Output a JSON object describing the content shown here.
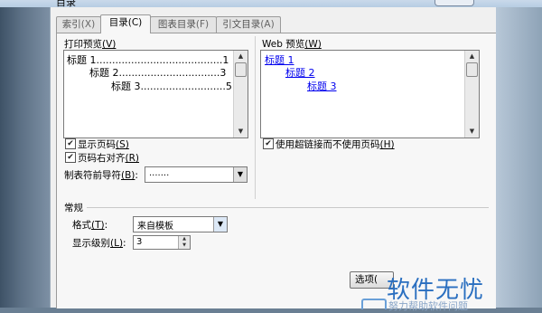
{
  "window": {
    "title": "目录"
  },
  "tabs": [
    {
      "label": "索引",
      "shortcut": "(X)"
    },
    {
      "label": "目录",
      "shortcut": "(C)"
    },
    {
      "label": "图表目录",
      "shortcut": "(F)"
    },
    {
      "label": "引文目录",
      "shortcut": "(A)"
    }
  ],
  "print_preview": {
    "label": "打印预览",
    "shortcut": "(V)",
    "lines": [
      {
        "text": "标题 1",
        "leader": "........................................",
        "page": "1"
      },
      {
        "text": "标题 2",
        "leader": "................................",
        "page": "3"
      },
      {
        "text": "标题 3",
        "leader": "...........................",
        "page": "5"
      }
    ]
  },
  "web_preview": {
    "label": "Web 预览",
    "shortcut": "(W)",
    "links": [
      "标题 1",
      "标题 2",
      "标题 3"
    ]
  },
  "options": {
    "show_page_numbers": {
      "label": "显示页码",
      "shortcut": "(S)",
      "checked": true
    },
    "right_align": {
      "label": "页码右对齐",
      "shortcut": "(R)",
      "checked": true
    },
    "tab_leader": {
      "label": "制表符前导符",
      "shortcut": "(B)",
      "colon": ":",
      "value": "......."
    },
    "use_hyperlinks": {
      "label": "使用超链接而不使用页码",
      "shortcut": "(H)",
      "checked": true
    }
  },
  "general": {
    "heading": "常规",
    "format": {
      "label": "格式",
      "shortcut": "(T)",
      "colon": ":",
      "value": "来自模板"
    },
    "levels": {
      "label": "显示级别",
      "shortcut": "(L)",
      "colon": ":",
      "value": "3"
    }
  },
  "buttons": {
    "options": "选项("
  },
  "watermark": {
    "brand": "软件无忧",
    "sub": "努力帮助软件问题"
  },
  "colors": {
    "link": "#0000ee",
    "dialog_bg": "#f0f0f0",
    "watermark": "#2a6fc0"
  }
}
